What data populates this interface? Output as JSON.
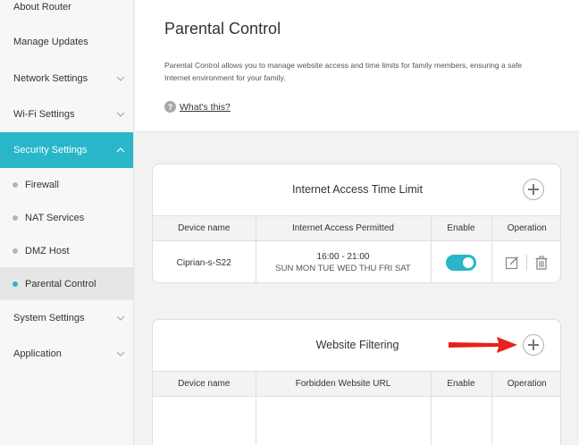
{
  "sidebar": {
    "items": [
      {
        "label": "About Router"
      },
      {
        "label": "Manage Updates"
      },
      {
        "label": "Network Settings"
      },
      {
        "label": "Wi-Fi Settings"
      },
      {
        "label": "Security Settings"
      },
      {
        "label": "Firewall"
      },
      {
        "label": "NAT Services"
      },
      {
        "label": "DMZ Host"
      },
      {
        "label": "Parental Control"
      },
      {
        "label": "System Settings"
      },
      {
        "label": "Application"
      }
    ]
  },
  "header": {
    "title": "Parental Control",
    "description": "Parental Control allows you to manage website access and time limits for family members, ensuring a safe Internet environment for your family.",
    "help_label": "What's this?"
  },
  "time_limit": {
    "title": "Internet Access Time Limit",
    "columns": [
      "Device name",
      "Internet Access Permitted",
      "Enable",
      "Operation"
    ],
    "rows": [
      {
        "device": "Ciprian-s-S22",
        "time": "16:00 - 21:00",
        "days": "SUN MON TUE WED THU FRI SAT",
        "enabled": true
      }
    ]
  },
  "website_filtering": {
    "title": "Website Filtering",
    "columns": [
      "Device name",
      "Forbidden Website URL",
      "Enable",
      "Operation"
    ]
  },
  "colors": {
    "accent": "#28b6c8",
    "arrow": "#e8211b"
  }
}
